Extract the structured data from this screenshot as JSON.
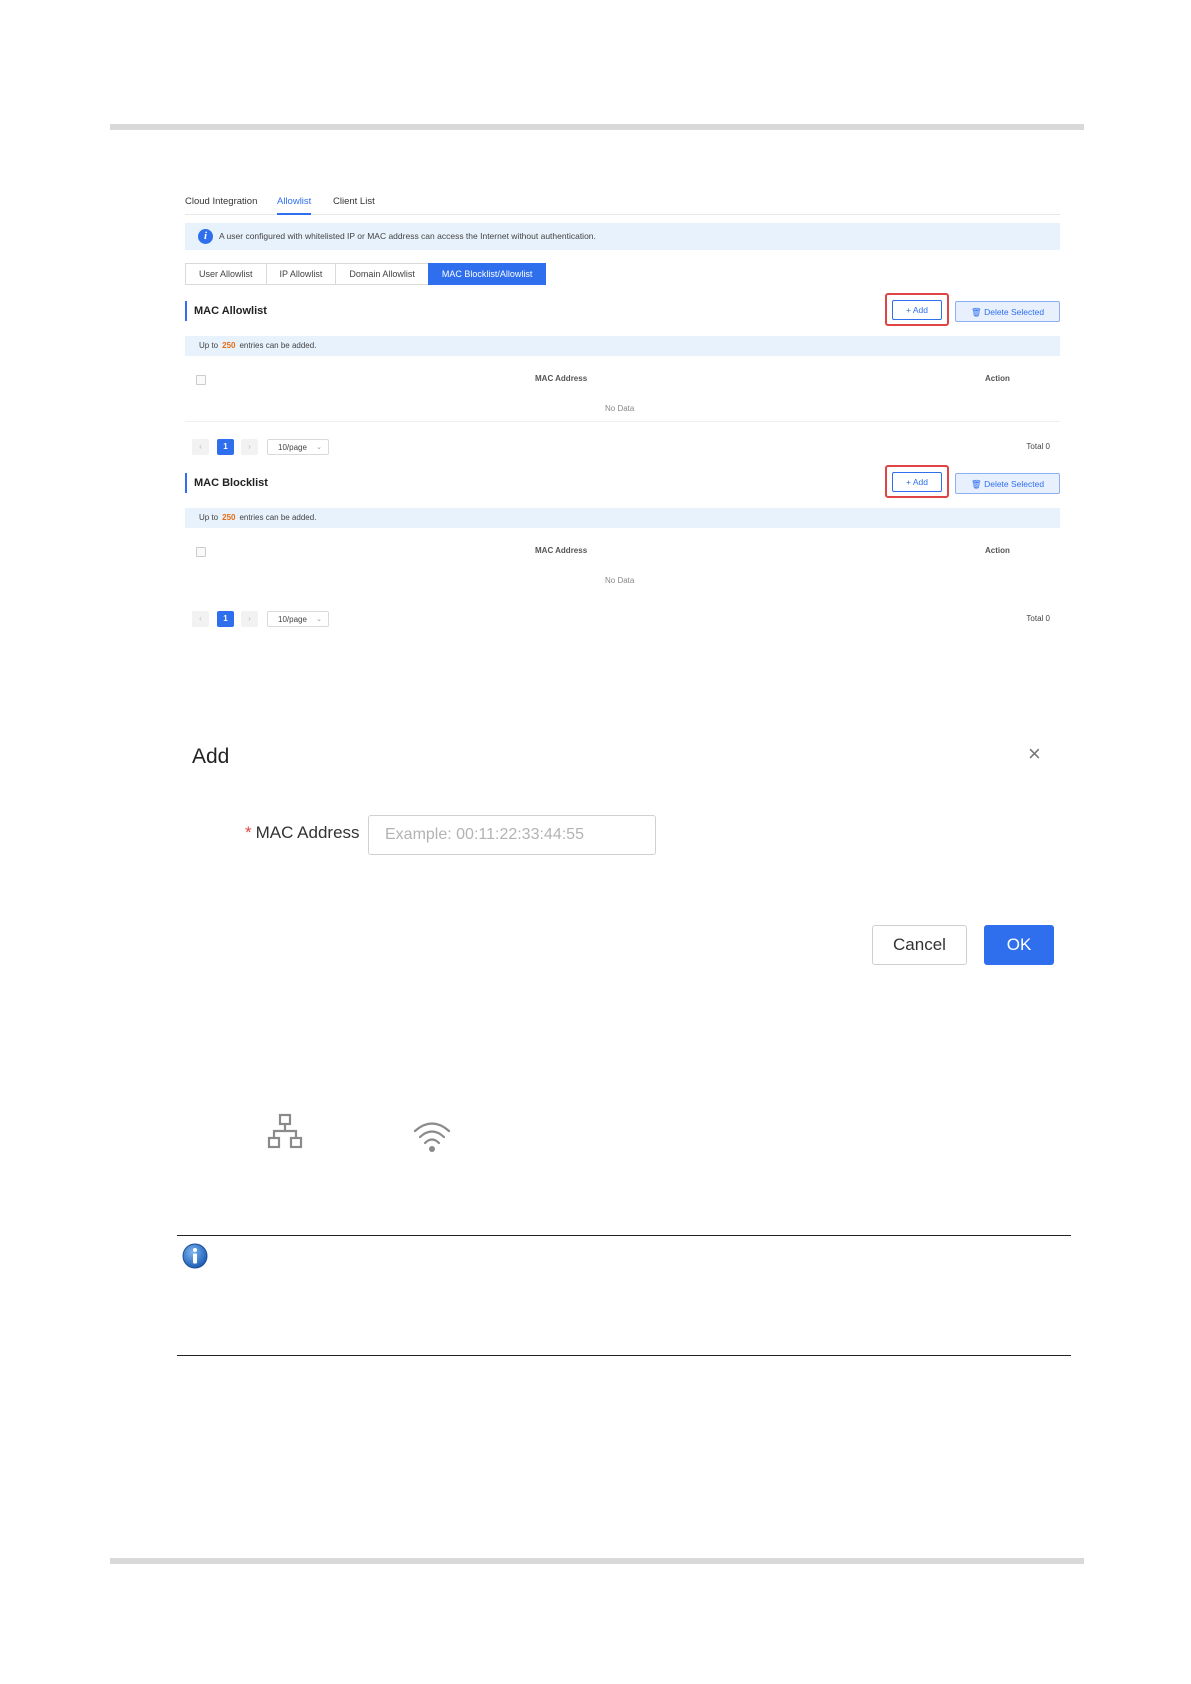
{
  "nav_tabs": [
    {
      "label": "Cloud Integration"
    },
    {
      "label": "Allowlist"
    },
    {
      "label": "Client List"
    }
  ],
  "info_bar": {
    "icon": "info-icon",
    "text": "A user configured with whitelisted IP or MAC address can access the Internet without authentication."
  },
  "sub_tabs": [
    {
      "label": "User Allowlist"
    },
    {
      "label": "IP Allowlist"
    },
    {
      "label": "Domain Allowlist"
    },
    {
      "label": "MAC Blocklist/Allowlist"
    }
  ],
  "allowlist": {
    "title": "MAC Allowlist",
    "add_label": "+ Add",
    "delete_label": "Delete Selected",
    "limit_prefix": "Up to",
    "limit_value": "250",
    "limit_suffix": "entries can be added.",
    "col_mac": "MAC Address",
    "col_action": "Action",
    "empty_text": "No Data",
    "page": "1",
    "page_size": "10/page",
    "total": "Total 0"
  },
  "blocklist": {
    "title": "MAC Blocklist",
    "add_label": "+ Add",
    "delete_label": "Delete Selected",
    "limit_prefix": "Up to",
    "limit_value": "250",
    "limit_suffix": "entries can be added.",
    "col_mac": "MAC Address",
    "col_action": "Action",
    "empty_text": "No Data",
    "page": "1",
    "page_size": "10/page",
    "total": "Total 0"
  },
  "dialog": {
    "title": "Add",
    "close": "×",
    "required_mark": "*",
    "field_label": "MAC Address",
    "field_placeholder": "Example: 00:11:22:33:44:55",
    "cancel_label": "Cancel",
    "ok_label": "OK"
  },
  "icons": [
    "network-topology-icon",
    "wifi-icon",
    "info-icon"
  ],
  "colors": {
    "accent": "#2f6fed",
    "highlight": "#e04545",
    "limit_number": "#e86a13",
    "info_bg": "#e8f2fc"
  }
}
